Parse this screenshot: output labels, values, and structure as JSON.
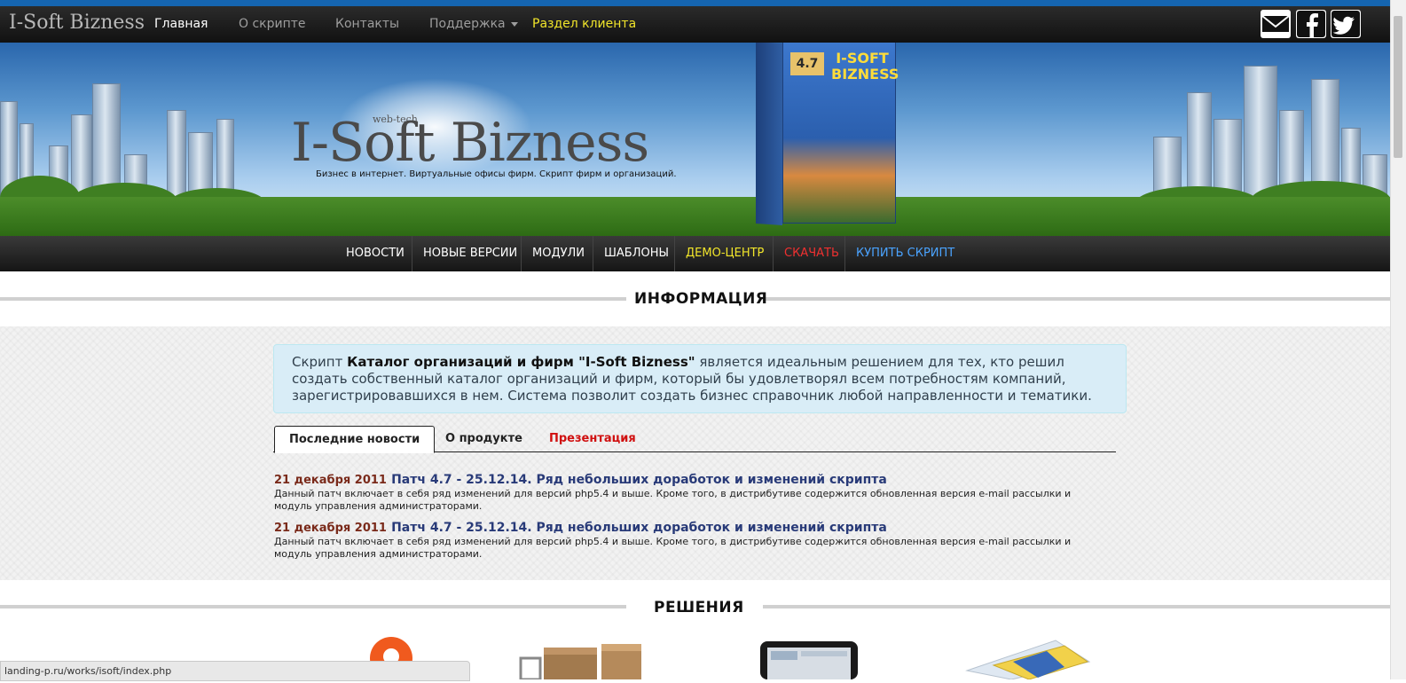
{
  "navbar": {
    "brand": "I-Soft Bizness",
    "items": [
      {
        "label": "Главная",
        "active": true
      },
      {
        "label": "О скрипте"
      },
      {
        "label": "Контакты"
      },
      {
        "label": "Поддержка",
        "dropdown": true
      },
      {
        "label": "Раздел клиента",
        "color": "#f1e52a"
      }
    ],
    "social_icons": [
      "mail-icon",
      "facebook-icon",
      "twitter-icon"
    ]
  },
  "banner": {
    "logo_prefix": "web-tech",
    "logo": "I-Soft Bizness",
    "tagline": "Бизнес в интернет. Виртуальные офисы фирм. Скрипт фирм и организаций.",
    "product_box": {
      "version": "4.7",
      "title": "I-SOFT BIZNESS"
    }
  },
  "menu": [
    {
      "label": "НОВОСТИ",
      "color": "#ffffff"
    },
    {
      "label": "НОВЫЕ ВЕРСИИ",
      "color": "#ffffff"
    },
    {
      "label": "МОДУЛИ",
      "color": "#ffffff"
    },
    {
      "label": "ШАБЛОНЫ",
      "color": "#ffffff"
    },
    {
      "label": "ДЕМО-ЦЕНТР",
      "color": "#f1e52a"
    },
    {
      "label": "СКАЧАТЬ",
      "color": "#f03030"
    },
    {
      "label": "КУПИТЬ СКРИПТ",
      "color": "#4aa3ff"
    }
  ],
  "info": {
    "heading": "ИНФОРМАЦИЯ",
    "alert_pre": "Скрипт ",
    "alert_bold": "Каталог организаций и фирм \"I-Soft Bizness\"",
    "alert_post": " является идеальным решением для тех, кто решил создать собственный каталог организаций и фирм, который бы удовлетворял всем потребностям компаний, зарегистрировавшихся в нем. Система позволит создать бизнес справочник любой направленности и тематики.",
    "tabs": [
      {
        "label": "Последние новости",
        "active": true
      },
      {
        "label": "О продукте"
      },
      {
        "label": "Презентация",
        "color": "#d01010"
      }
    ],
    "news": [
      {
        "date": "21 декабря 2011",
        "title": "Патч 4.7 - 25.12.14. Ряд небольших доработок и изменений скрипта",
        "text": "Данный патч включает в себя ряд изменений для версий php5.4 и выше. Кроме того, в дистрибутиве содержится обновленная версия e-mail рассылки и модуль управления администраторами."
      },
      {
        "date": "21 декабря 2011",
        "title": "Патч 4.7 - 25.12.14. Ряд небольших доработок и изменений скрипта",
        "text": "Данный патч включает в себя ряд изменений для версий php5.4 и выше. Кроме того, в дистрибутиве содержится обновленная версия e-mail рассылки и модуль управления администраторами."
      }
    ]
  },
  "solutions": {
    "heading": "РЕШЕНИЯ",
    "icons": [
      "location-pin-icon",
      "boxes-icon",
      "tablet-icon",
      "documents-icon"
    ]
  },
  "status_url": "landing-p.ru/works/isoft/index.php"
}
